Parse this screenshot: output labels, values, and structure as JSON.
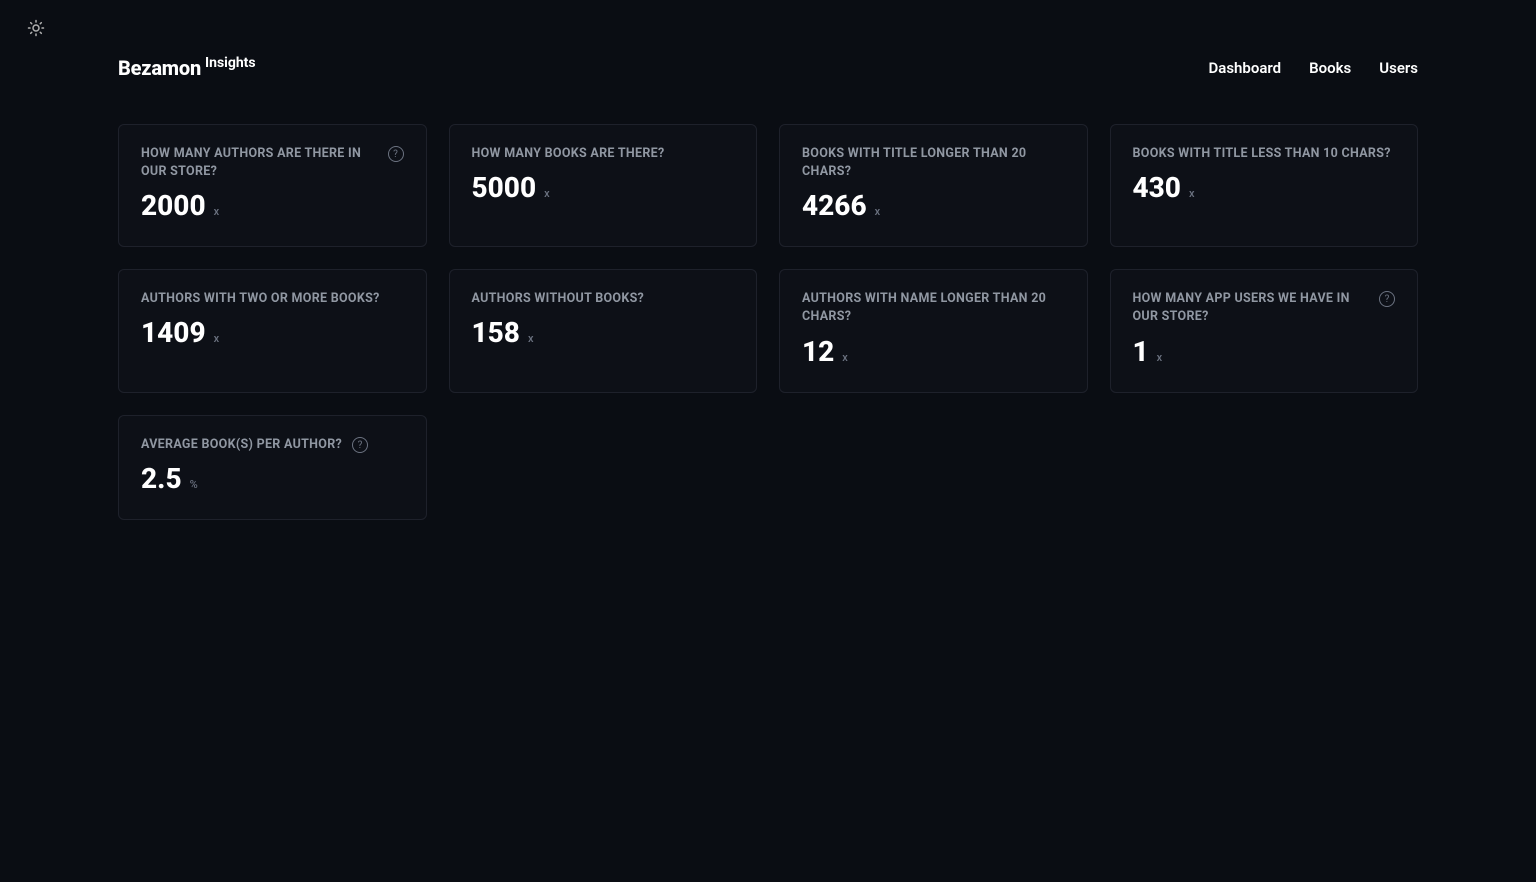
{
  "logo": {
    "main": "Bezamon",
    "sub": "Insights"
  },
  "nav": {
    "dashboard": "Dashboard",
    "books": "Books",
    "users": "Users"
  },
  "cards": [
    {
      "title": "HOW MANY AUTHORS ARE THERE IN OUR STORE?",
      "value": "2000",
      "unit": "x",
      "help": true
    },
    {
      "title": "HOW MANY BOOKS ARE THERE?",
      "value": "5000",
      "unit": "x",
      "help": false
    },
    {
      "title": "BOOKS WITH TITLE LONGER THAN 20 CHARS?",
      "value": "4266",
      "unit": "x",
      "help": false
    },
    {
      "title": "BOOKS WITH TITLE LESS THAN 10 CHARS?",
      "value": "430",
      "unit": "x",
      "help": false
    },
    {
      "title": "AUTHORS WITH TWO OR MORE BOOKS?",
      "value": "1409",
      "unit": "x",
      "help": false
    },
    {
      "title": "AUTHORS WITHOUT BOOKS?",
      "value": "158",
      "unit": "x",
      "help": false
    },
    {
      "title": "AUTHORS WITH NAME LONGER THAN 20 CHARS?",
      "value": "12",
      "unit": "x",
      "help": false
    },
    {
      "title": "HOW MANY APP USERS WE HAVE IN OUR STORE?",
      "value": "1",
      "unit": "x",
      "help": true
    },
    {
      "title": "AVERAGE BOOK(S) PER AUTHOR?",
      "value": "2.5",
      "unit": "%",
      "help": true,
      "helpInline": true
    }
  ]
}
